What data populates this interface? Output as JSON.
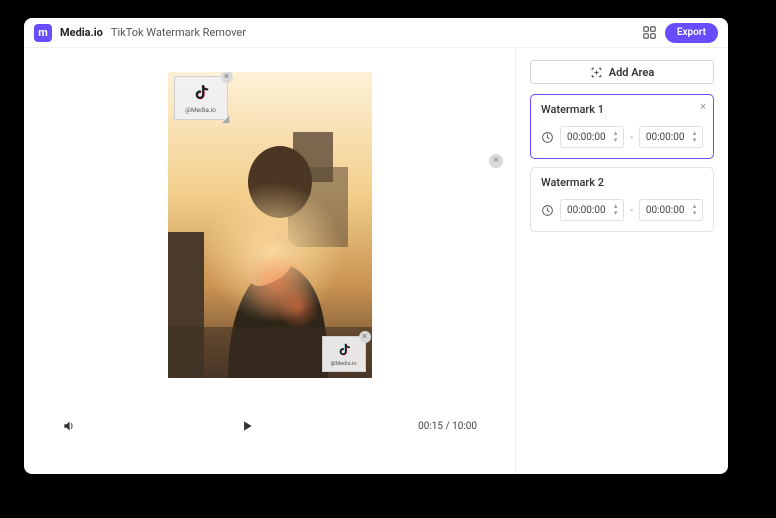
{
  "header": {
    "logo_letter": "m",
    "brand": "Media.io",
    "title": "TikTok Watermark Remover",
    "export_label": "Export"
  },
  "preview": {
    "watermark_tag": "@Media.io",
    "time_display": "00:15 / 10:00"
  },
  "side": {
    "add_area_label": "Add Area",
    "watermarks": [
      {
        "title": "Watermark 1",
        "start": "00:00:00",
        "end": "00:00:00",
        "selected": true,
        "closable": true
      },
      {
        "title": "Watermark 2",
        "start": "00:00:00",
        "end": "00:00:00",
        "selected": false,
        "closable": false
      }
    ]
  }
}
